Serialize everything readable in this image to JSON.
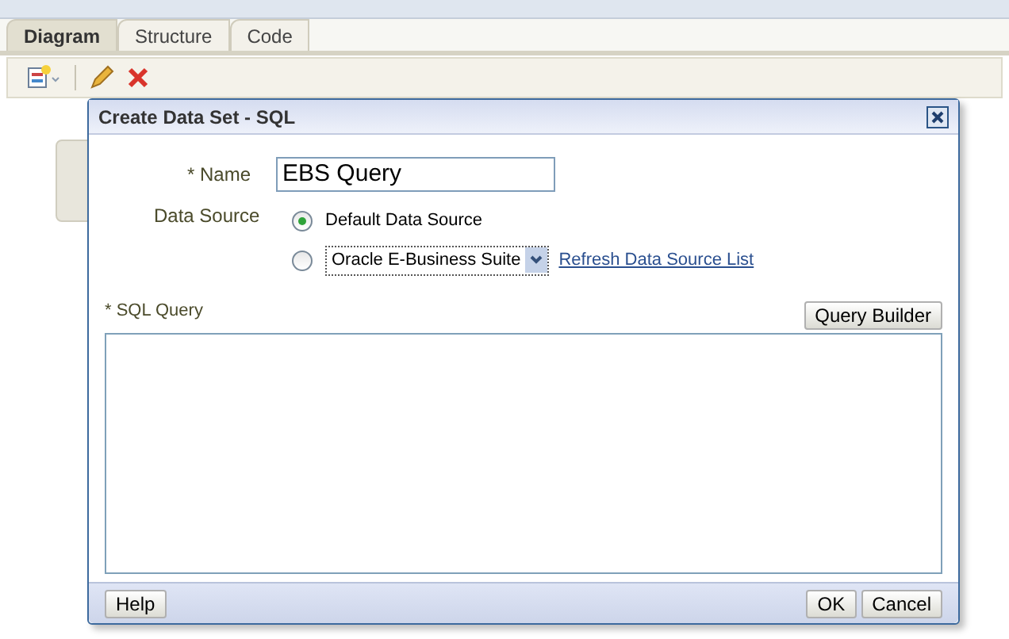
{
  "tabs": [
    {
      "label": "Diagram",
      "selected": true
    },
    {
      "label": "Structure",
      "selected": false
    },
    {
      "label": "Code",
      "selected": false
    }
  ],
  "dialog": {
    "title": "Create Data Set - SQL",
    "name": {
      "label": "* Name",
      "value": "EBS Query"
    },
    "data_source": {
      "label": "Data Source",
      "options": [
        {
          "kind": "text",
          "label": "Default Data Source",
          "selected": true
        },
        {
          "kind": "select",
          "value": "Oracle E-Business Suite",
          "selected": false
        }
      ],
      "link": "Refresh Data Source List"
    },
    "sql_query": {
      "label": "* SQL Query",
      "button": "Query Builder"
    },
    "buttons": {
      "help": "Help",
      "ok": "OK",
      "cancel": "Cancel"
    }
  }
}
